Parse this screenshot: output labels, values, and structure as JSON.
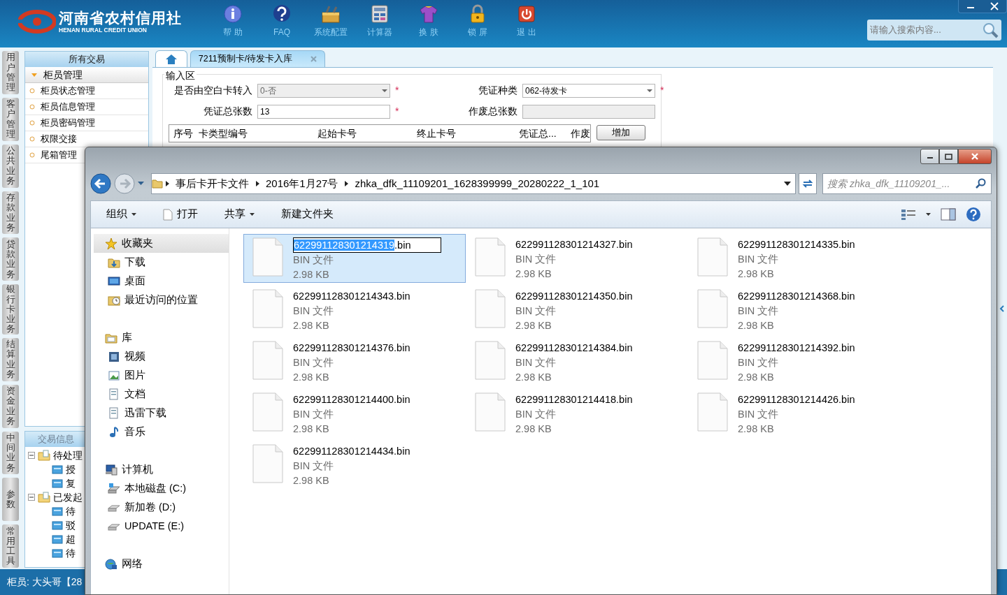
{
  "app": {
    "logo_cn": "河南省农村信用社",
    "logo_en": "HENAN RURAL CREDIT UNION",
    "toolbar": [
      {
        "label": "帮 助",
        "kind": "info"
      },
      {
        "label": "FAQ",
        "kind": "help"
      },
      {
        "label": "系统配置",
        "kind": "toolbox"
      },
      {
        "label": "计算器",
        "kind": "calculator"
      },
      {
        "label": "换 肤",
        "kind": "shirt"
      },
      {
        "label": "锁 屏",
        "kind": "lock"
      },
      {
        "label": "退 出",
        "kind": "power"
      }
    ],
    "search": {
      "placeholder": "请输入搜索内容..."
    },
    "side_tabs": [
      "用户管理",
      "客户管理",
      "公共业务",
      "存款业务",
      "贷款业务",
      "银行卡业务",
      "结算业务",
      "资金业务",
      "中间业务",
      "参数",
      "常用工具"
    ],
    "sidebar": {
      "title": "所有交易",
      "group": {
        "label": "柜员管理",
        "expanded": true
      },
      "items": [
        "柜员状态管理",
        "柜员信息管理",
        "柜员密码管理",
        "权限交接",
        "尾箱管理"
      ]
    },
    "info_panel": {
      "title": "交易信息",
      "tree": [
        {
          "label": "待处理",
          "expanded": true,
          "children": [
            {
              "label": "授"
            },
            {
              "label": "复"
            }
          ]
        },
        {
          "label": "已发起",
          "expanded": true,
          "children": [
            {
              "label": "待"
            },
            {
              "label": "驳"
            },
            {
              "label": "超"
            },
            {
              "label": "待"
            }
          ]
        }
      ]
    },
    "status_bar": "柜员: 大头哥【28",
    "tabs": [
      {
        "kind": "home",
        "selected": false
      },
      {
        "kind": "page",
        "label": "7211预制卡/待发卡入库",
        "selected": true
      }
    ],
    "form": {
      "legend": "输入区",
      "fields": [
        {
          "label": "是否由空白卡转入",
          "kind": "select",
          "value": "0-否",
          "disabled": true,
          "required_mark": "*"
        },
        {
          "label": "凭证种类",
          "kind": "select",
          "value": "062-待发卡",
          "disabled": false,
          "required_mark": "*"
        },
        {
          "label": "凭证总张数",
          "kind": "text",
          "value": "13",
          "disabled": false,
          "required_mark": "*"
        },
        {
          "label": "作废总张数",
          "kind": "text",
          "disabled": true
        }
      ],
      "table": {
        "columns": [
          "序号",
          "卡类型编号",
          "起始卡号",
          "终止卡号",
          "凭证总...",
          "作废"
        ]
      },
      "add_button": "增加"
    }
  },
  "explorer": {
    "breadcrumb": [
      "事后卡开卡文件",
      "2016年1月27号",
      "zhka_dfk_11109201_1628399999_20280222_1_101"
    ],
    "search": {
      "placeholder": "搜索 zhka_dfk_11109201_..."
    },
    "toolbar": [
      {
        "label": "组织",
        "dropdown": true,
        "kind": "plain"
      },
      {
        "label": "打开",
        "dropdown": false,
        "kind": "open"
      },
      {
        "label": "共享",
        "dropdown": true,
        "kind": "plain"
      },
      {
        "label": "新建文件夹",
        "dropdown": false,
        "kind": "plain"
      }
    ],
    "nav": [
      {
        "label": "收藏夹",
        "kind": "star",
        "selected": true,
        "children": [
          {
            "label": "下载",
            "kind": "downloads",
            "selected": false
          },
          {
            "label": "桌面",
            "kind": "desktop",
            "selected": false
          },
          {
            "label": "最近访问的位置",
            "kind": "recent",
            "selected": false
          }
        ]
      },
      {
        "label": "库",
        "kind": "library",
        "selected": false,
        "children": [
          {
            "label": "视频",
            "kind": "video",
            "selected": false
          },
          {
            "label": "图片",
            "kind": "pictures",
            "selected": false
          },
          {
            "label": "文档",
            "kind": "documents",
            "selected": false
          },
          {
            "label": "迅雷下载",
            "kind": "documents",
            "selected": false
          },
          {
            "label": "音乐",
            "kind": "music",
            "selected": false
          }
        ]
      },
      {
        "label": "计算机",
        "kind": "computer",
        "selected": false,
        "children": [
          {
            "label": "本地磁盘 (C:)",
            "kind": "system_drive",
            "selected": false
          },
          {
            "label": "新加卷 (D:)",
            "kind": "drive",
            "selected": false
          },
          {
            "label": "UPDATE (E:)",
            "kind": "drive",
            "selected": false
          }
        ]
      },
      {
        "label": "网络",
        "kind": "network",
        "selected": false
      }
    ],
    "files": [
      {
        "name": "622991128301214319.bin",
        "type": "BIN 文件",
        "size": "2.98 KB",
        "selected": true,
        "renaming": true
      },
      {
        "name": "622991128301214327.bin",
        "type": "BIN 文件",
        "size": "2.98 KB",
        "selected": false,
        "renaming": false
      },
      {
        "name": "622991128301214335.bin",
        "type": "BIN 文件",
        "size": "2.98 KB",
        "selected": false,
        "renaming": false
      },
      {
        "name": "622991128301214343.bin",
        "type": "BIN 文件",
        "size": "2.98 KB",
        "selected": false,
        "renaming": false
      },
      {
        "name": "622991128301214350.bin",
        "type": "BIN 文件",
        "size": "2.98 KB",
        "selected": false,
        "renaming": false
      },
      {
        "name": "622991128301214368.bin",
        "type": "BIN 文件",
        "size": "2.98 KB",
        "selected": false,
        "renaming": false
      },
      {
        "name": "622991128301214376.bin",
        "type": "BIN 文件",
        "size": "2.98 KB",
        "selected": false,
        "renaming": false
      },
      {
        "name": "622991128301214384.bin",
        "type": "BIN 文件",
        "size": "2.98 KB",
        "selected": false,
        "renaming": false
      },
      {
        "name": "622991128301214392.bin",
        "type": "BIN 文件",
        "size": "2.98 KB",
        "selected": false,
        "renaming": false
      },
      {
        "name": "622991128301214400.bin",
        "type": "BIN 文件",
        "size": "2.98 KB",
        "selected": false,
        "renaming": false
      },
      {
        "name": "622991128301214418.bin",
        "type": "BIN 文件",
        "size": "2.98 KB",
        "selected": false,
        "renaming": false
      },
      {
        "name": "622991128301214426.bin",
        "type": "BIN 文件",
        "size": "2.98 KB",
        "selected": false,
        "renaming": false
      },
      {
        "name": "622991128301214434.bin",
        "type": "BIN 文件",
        "size": "2.98 KB",
        "selected": false,
        "renaming": false
      }
    ]
  }
}
